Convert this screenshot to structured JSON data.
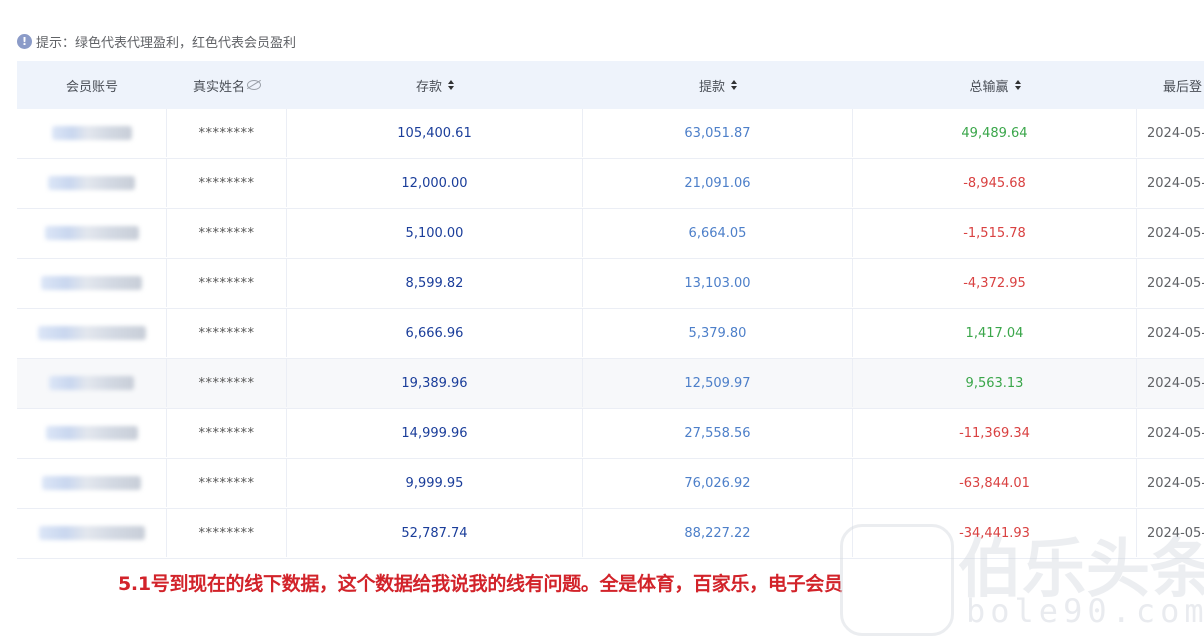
{
  "tip": {
    "icon": "info-icon",
    "text": "提示：绿色代表代理盈利，红色代表会员盈利"
  },
  "table": {
    "headers": {
      "account": "会员账号",
      "real_name": "真实姓名",
      "deposit": "存款",
      "withdrawal": "提款",
      "total_win_loss": "总输赢",
      "last_login": "最后登"
    },
    "colors": {
      "deposit": "#1a3d9a",
      "withdrawal": "#4d7fc9",
      "agent_profit": "#3aa64a",
      "member_profit": "#d94141"
    },
    "rows": [
      {
        "name": "********",
        "deposit": "105,400.61",
        "withdrawal": "63,051.87",
        "total": "49,489.64",
        "sign": "pos",
        "last": "2024-05-"
      },
      {
        "name": "********",
        "deposit": "12,000.00",
        "withdrawal": "21,091.06",
        "total": "-8,945.68",
        "sign": "neg",
        "last": "2024-05-"
      },
      {
        "name": "********",
        "deposit": "5,100.00",
        "withdrawal": "6,664.05",
        "total": "-1,515.78",
        "sign": "neg",
        "last": "2024-05-"
      },
      {
        "name": "********",
        "deposit": "8,599.82",
        "withdrawal": "13,103.00",
        "total": "-4,372.95",
        "sign": "neg",
        "last": "2024-05-"
      },
      {
        "name": "********",
        "deposit": "6,666.96",
        "withdrawal": "5,379.80",
        "total": "1,417.04",
        "sign": "pos",
        "last": "2024-05-"
      },
      {
        "name": "********",
        "deposit": "19,389.96",
        "withdrawal": "12,509.97",
        "total": "9,563.13",
        "sign": "pos",
        "last": "2024-05-"
      },
      {
        "name": "********",
        "deposit": "14,999.96",
        "withdrawal": "27,558.56",
        "total": "-11,369.34",
        "sign": "neg",
        "last": "2024-05-"
      },
      {
        "name": "********",
        "deposit": "9,999.95",
        "withdrawal": "76,026.92",
        "total": "-63,844.01",
        "sign": "neg",
        "last": "2024-05-"
      },
      {
        "name": "********",
        "deposit": "52,787.74",
        "withdrawal": "88,227.22",
        "total": "-34,441.93",
        "sign": "neg",
        "last": "2024-05-"
      }
    ]
  },
  "caption": "5.1号到现在的线下数据，这个数据给我说我的线有问题。全是体育，百家乐，电子会员",
  "watermark": {
    "text": "伯乐头条",
    "sub": "bole90.com"
  }
}
